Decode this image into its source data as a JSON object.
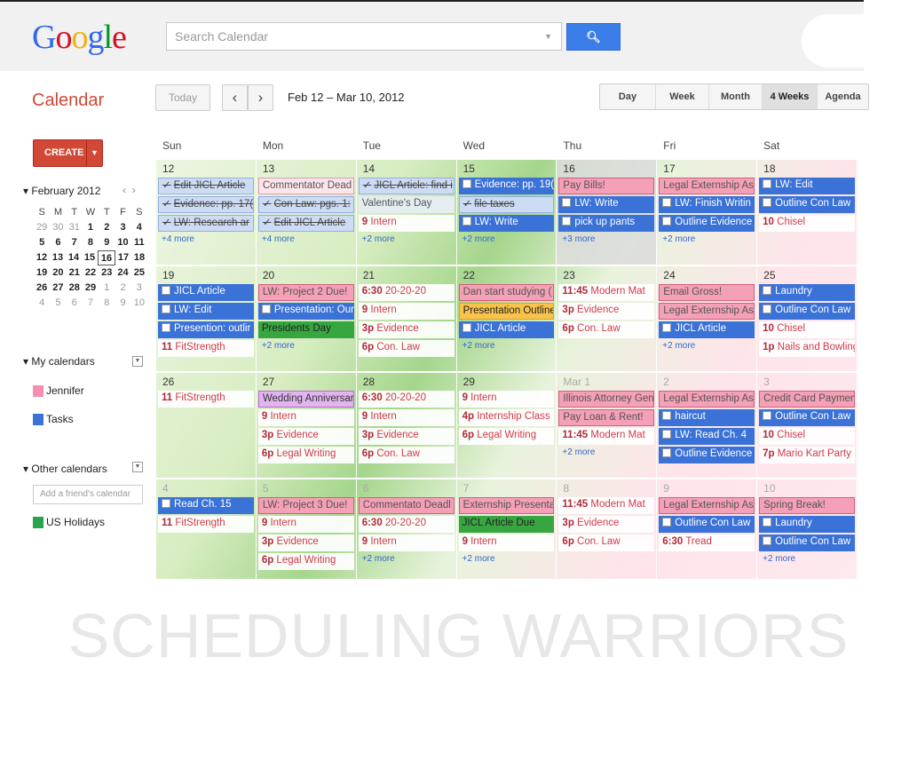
{
  "header": {
    "logo": "Google",
    "search_placeholder": "Search Calendar",
    "app_name": "Calendar",
    "today_label": "Today",
    "date_range": "Feb 12 – Mar 10, 2012",
    "views": [
      "Day",
      "Week",
      "Month",
      "4 Weeks",
      "Agenda"
    ],
    "selected_view": "4 Weeks"
  },
  "sidebar": {
    "create_label": "CREATE",
    "mini_cal_title": "February 2012",
    "weekday_letters": [
      "S",
      "M",
      "T",
      "W",
      "T",
      "F",
      "S"
    ],
    "mini_weeks": [
      [
        "29",
        "30",
        "31",
        "1",
        "2",
        "3",
        "4"
      ],
      [
        "5",
        "6",
        "7",
        "8",
        "9",
        "10",
        "11"
      ],
      [
        "12",
        "13",
        "14",
        "15",
        "16",
        "17",
        "18"
      ],
      [
        "19",
        "20",
        "21",
        "22",
        "23",
        "24",
        "25"
      ],
      [
        "26",
        "27",
        "28",
        "29",
        "1",
        "2",
        "3"
      ],
      [
        "4",
        "5",
        "6",
        "7",
        "8",
        "9",
        "10"
      ]
    ],
    "mini_today": "16",
    "my_calendars_title": "My calendars",
    "my_calendars": [
      {
        "name": "Jennifer",
        "color": "#f48fb1"
      },
      {
        "name": "Tasks",
        "color": "#3a72d8"
      }
    ],
    "other_calendars_title": "Other calendars",
    "add_friend_placeholder": "Add a friend's calendar",
    "other_calendars": [
      {
        "name": "US Holidays",
        "color": "#2aa44a"
      }
    ]
  },
  "grid": {
    "days": [
      "Sun",
      "Mon",
      "Tue",
      "Wed",
      "Thu",
      "Fri",
      "Sat"
    ],
    "weeks": [
      [
        {
          "date": "12",
          "events": [
            {
              "t": "Edit JICL Article",
              "s": "bluel",
              "check": true,
              "strike": true
            },
            {
              "t": "Evidence: pp. 17(",
              "s": "bluel",
              "check": true,
              "strike": true
            },
            {
              "t": "LW: Research ar",
              "s": "bluel",
              "check": true,
              "strike": true
            }
          ],
          "more": "+4 more"
        },
        {
          "date": "13",
          "events": [
            {
              "t": "Commentator Dead",
              "s": "pinkl"
            },
            {
              "t": "Con Law: pgs. 1:",
              "s": "bluel",
              "check": true,
              "strike": true
            },
            {
              "t": "Edit JICL Article",
              "s": "bluel",
              "check": true,
              "strike": true
            }
          ],
          "more": "+4 more"
        },
        {
          "date": "14",
          "events": [
            {
              "t": "JICL Article: find i",
              "s": "bluel",
              "check": true,
              "strike": true
            },
            {
              "t": "Valentine's Day",
              "s": "text2"
            },
            {
              "t": "Intern",
              "time": "9",
              "s": "text"
            }
          ],
          "more": "+2 more"
        },
        {
          "date": "15",
          "events": [
            {
              "t": "Evidence: pp. 19(",
              "s": "blue",
              "box": true
            },
            {
              "t": "file taxes",
              "s": "bluel",
              "check": true,
              "strike": true
            },
            {
              "t": "LW: Write",
              "s": "blue",
              "box": true
            }
          ],
          "more": "+2 more"
        },
        {
          "date": "16",
          "events": [
            {
              "t": "Pay Bills!",
              "s": "pink"
            },
            {
              "t": "LW: Write",
              "s": "blue",
              "box": true
            },
            {
              "t": "pick up pants",
              "s": "blue",
              "box": true
            }
          ],
          "more": "+3 more"
        },
        {
          "date": "17",
          "events": [
            {
              "t": "Legal Externship As",
              "s": "pink"
            },
            {
              "t": "LW: Finish Writin",
              "s": "blue",
              "box": true
            },
            {
              "t": "Outline Evidence",
              "s": "blue",
              "box": true
            }
          ],
          "more": "+2 more"
        },
        {
          "date": "18",
          "events": [
            {
              "t": "LW: Edit",
              "s": "blue",
              "box": true
            },
            {
              "t": "Outline Con Law",
              "s": "blue",
              "box": true
            },
            {
              "t": "Chisel",
              "time": "10",
              "s": "text"
            }
          ],
          "more": ""
        }
      ],
      [
        {
          "date": "19",
          "events": [
            {
              "t": "JICL Article",
              "s": "blue",
              "box": true
            },
            {
              "t": "LW: Edit",
              "s": "blue",
              "box": true
            },
            {
              "t": "Presention: outlir",
              "s": "blue",
              "box": true
            },
            {
              "t": "FitStrength",
              "time": "11",
              "s": "text"
            }
          ],
          "more": ""
        },
        {
          "date": "20",
          "events": [
            {
              "t": "LW: Project 2 Due!",
              "s": "pink"
            },
            {
              "t": "Presentation: Our",
              "s": "blue",
              "box": true
            },
            {
              "t": "Presidents Day",
              "s": "green"
            }
          ],
          "more": "+2 more"
        },
        {
          "date": "21",
          "events": [
            {
              "t": "20-20-20",
              "time": "6:30",
              "s": "text"
            },
            {
              "t": "Intern",
              "time": "9",
              "s": "text"
            },
            {
              "t": "Evidence",
              "time": "3p",
              "s": "text"
            },
            {
              "t": "Con. Law",
              "time": "6p",
              "s": "text"
            }
          ],
          "more": ""
        },
        {
          "date": "22",
          "events": [
            {
              "t": "Dan start studying (",
              "s": "pink"
            },
            {
              "t": "Presentation Outline",
              "s": "orange"
            },
            {
              "t": "JICL Article",
              "s": "blue",
              "box": true
            }
          ],
          "more": "+2 more"
        },
        {
          "date": "23",
          "events": [
            {
              "t": "Modern Mat",
              "time": "11:45",
              "s": "text"
            },
            {
              "t": "Evidence",
              "time": "3p",
              "s": "text"
            },
            {
              "t": "Con. Law",
              "time": "6p",
              "s": "text"
            }
          ],
          "more": ""
        },
        {
          "date": "24",
          "events": [
            {
              "t": "Email Gross!",
              "s": "pink"
            },
            {
              "t": "Legal Externship As",
              "s": "pink"
            },
            {
              "t": "JICL Article",
              "s": "blue",
              "box": true
            }
          ],
          "more": "+2 more"
        },
        {
          "date": "25",
          "events": [
            {
              "t": "Laundry",
              "s": "blue",
              "box": true
            },
            {
              "t": "Outline Con Law",
              "s": "blue",
              "box": true
            },
            {
              "t": "Chisel",
              "time": "10",
              "s": "text"
            },
            {
              "t": "Nails and Bowling w",
              "time": "1p",
              "s": "text"
            }
          ],
          "more": ""
        }
      ],
      [
        {
          "date": "26",
          "events": [
            {
              "t": "FitStrength",
              "time": "11",
              "s": "text"
            }
          ],
          "more": ""
        },
        {
          "date": "27",
          "events": [
            {
              "t": "Wedding Anniversar",
              "s": "purple"
            },
            {
              "t": "Intern",
              "time": "9",
              "s": "text"
            },
            {
              "t": "Evidence",
              "time": "3p",
              "s": "text"
            },
            {
              "t": "Legal Writing",
              "time": "6p",
              "s": "text"
            }
          ],
          "more": ""
        },
        {
          "date": "28",
          "events": [
            {
              "t": "20-20-20",
              "time": "6:30",
              "s": "text"
            },
            {
              "t": "Intern",
              "time": "9",
              "s": "text"
            },
            {
              "t": "Evidence",
              "time": "3p",
              "s": "text"
            },
            {
              "t": "Con. Law",
              "time": "6p",
              "s": "text"
            }
          ],
          "more": ""
        },
        {
          "date": "29",
          "events": [
            {
              "t": "Intern",
              "time": "9",
              "s": "text"
            },
            {
              "t": "Internship Class",
              "time": "4p",
              "s": "text"
            },
            {
              "t": "Legal Writing",
              "time": "6p",
              "s": "text"
            }
          ],
          "more": ""
        },
        {
          "date": "Mar 1",
          "dim": true,
          "events": [
            {
              "t": "Illinois Attorney Gen",
              "s": "pink"
            },
            {
              "t": "Pay Loan & Rent!",
              "s": "pink"
            },
            {
              "t": "Modern Mat",
              "time": "11:45",
              "s": "text"
            }
          ],
          "more": "+2 more"
        },
        {
          "date": "2",
          "dim": true,
          "events": [
            {
              "t": "Legal Externship As",
              "s": "pink"
            },
            {
              "t": "haircut",
              "s": "blue",
              "box": true
            },
            {
              "t": "LW: Read Ch. 4",
              "s": "blue",
              "box": true
            },
            {
              "t": "Outline Evidence",
              "s": "blue",
              "box": true
            }
          ],
          "more": ""
        },
        {
          "date": "3",
          "dim": true,
          "events": [
            {
              "t": "Credit Card Paymen",
              "s": "pink"
            },
            {
              "t": "Outline Con Law",
              "s": "blue",
              "box": true
            },
            {
              "t": "Chisel",
              "time": "10",
              "s": "text"
            },
            {
              "t": "Mario Kart Party",
              "time": "7p",
              "s": "text"
            }
          ],
          "more": ""
        }
      ],
      [
        {
          "date": "4",
          "dim": true,
          "events": [
            {
              "t": "Read Ch. 15",
              "s": "blue",
              "box": true
            },
            {
              "t": "FitStrength",
              "time": "11",
              "s": "text"
            }
          ],
          "more": ""
        },
        {
          "date": "5",
          "dim": true,
          "events": [
            {
              "t": "LW: Project 3 Due!",
              "s": "pink"
            },
            {
              "t": "Intern",
              "time": "9",
              "s": "text"
            },
            {
              "t": "Evidence",
              "time": "3p",
              "s": "text"
            },
            {
              "t": "Legal Writing",
              "time": "6p",
              "s": "text"
            }
          ],
          "more": ""
        },
        {
          "date": "6",
          "dim": true,
          "events": [
            {
              "t": "Commentato Deadl",
              "s": "pink"
            },
            {
              "t": "20-20-20",
              "time": "6:30",
              "s": "text"
            },
            {
              "t": "Intern",
              "time": "9",
              "s": "text"
            }
          ],
          "more": "+2 more"
        },
        {
          "date": "7",
          "dim": true,
          "events": [
            {
              "t": "Externship Presenta",
              "s": "pink"
            },
            {
              "t": "JICL Article Due",
              "s": "green"
            },
            {
              "t": "Intern",
              "time": "9",
              "s": "text"
            }
          ],
          "more": "+2 more"
        },
        {
          "date": "8",
          "dim": true,
          "events": [
            {
              "t": "Modern Mat",
              "time": "11:45",
              "s": "text"
            },
            {
              "t": "Evidence",
              "time": "3p",
              "s": "text"
            },
            {
              "t": "Con. Law",
              "time": "6p",
              "s": "text"
            }
          ],
          "more": ""
        },
        {
          "date": "9",
          "dim": true,
          "events": [
            {
              "t": "Legal Externship As",
              "s": "pink"
            },
            {
              "t": "Outline Con Law",
              "s": "blue",
              "box": true
            },
            {
              "t": "Tread",
              "time": "6:30",
              "s": "text"
            }
          ],
          "more": ""
        },
        {
          "date": "10",
          "dim": true,
          "events": [
            {
              "t": "Spring Break!",
              "s": "pink"
            },
            {
              "t": "Laundry",
              "s": "blue",
              "box": true
            },
            {
              "t": "Outline Con Law",
              "s": "blue",
              "box": true
            }
          ],
          "more": "+2 more"
        }
      ]
    ]
  },
  "watermark": "SCHEDULING WARRIORS"
}
